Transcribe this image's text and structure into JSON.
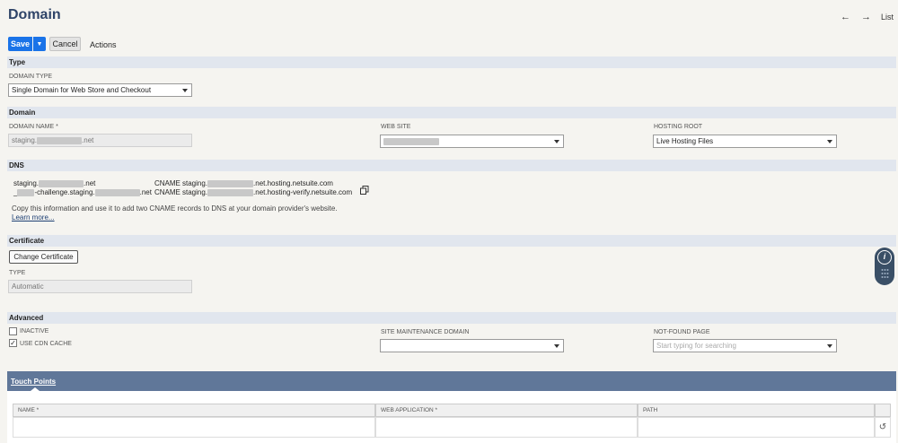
{
  "header": {
    "title": "Domain",
    "prev": "←",
    "next": "→",
    "list": "List"
  },
  "toolbar": {
    "save": "Save",
    "cancel": "Cancel",
    "actions": "Actions"
  },
  "sections": {
    "type": "Type",
    "domain": "Domain",
    "dns": "DNS",
    "certificate": "Certificate",
    "advanced": "Advanced"
  },
  "type_section": {
    "domain_type_label": "DOMAIN TYPE",
    "domain_type_value": "Single Domain for Web Store and Checkout"
  },
  "domain_section": {
    "domain_name_label": "DOMAIN NAME *",
    "domain_name_prefix": "staging.",
    "domain_name_suffix": ".net",
    "web_site_label": "WEB SITE",
    "hosting_root_label": "HOSTING ROOT",
    "hosting_root_value": "Live Hosting Files"
  },
  "dns_section": {
    "row1_host_prefix": "staging.",
    "row1_host_suffix": ".net",
    "row1_type": "CNAME",
    "row1_target_prefix": "staging.",
    "row1_target_suffix": ".net.hosting.netsuite.com",
    "row2_host_prefix": "_",
    "row2_host_mid": "-challenge.staging.",
    "row2_host_suffix": ".net",
    "row2_type": "CNAME",
    "row2_target_prefix": "staging.",
    "row2_target_suffix": ".net.hosting-verify.netsuite.com",
    "info_text": "Copy this information and use it to add two CNAME records to DNS at your domain provider's website.",
    "learn_more": "Learn more..."
  },
  "certificate_section": {
    "change_button": "Change Certificate",
    "type_label": "TYPE",
    "type_value": "Automatic"
  },
  "advanced_section": {
    "inactive_label": "INACTIVE",
    "inactive_checked": false,
    "use_cdn_label": "USE CDN CACHE",
    "use_cdn_checked": true,
    "checkmark": "✓",
    "maintenance_label": "SITE MAINTENANCE DOMAIN",
    "not_found_label": "NOT-FOUND PAGE",
    "not_found_placeholder": "Start typing for searching"
  },
  "touch_points": {
    "title": "Touch Points",
    "columns": [
      "NAME *",
      "WEB APPLICATION *",
      "PATH"
    ],
    "undo_icon": "↺"
  },
  "colors": {
    "primary": "#1a73e8",
    "title": "#2f4468",
    "section_bg": "#e1e6ee",
    "subtab_bg": "#607799"
  }
}
